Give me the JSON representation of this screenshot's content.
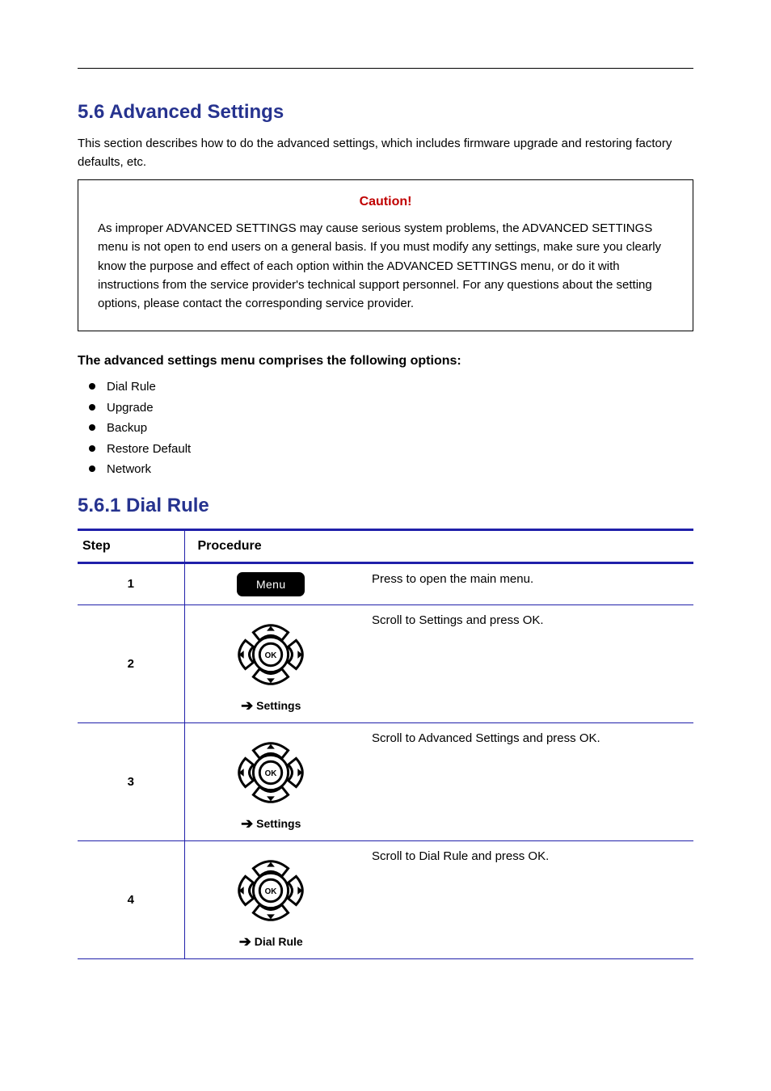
{
  "section5_6": {
    "heading": "5.6 Advanced Settings",
    "intro": "This section describes how to do the advanced settings, which includes firmware upgrade and restoring factory defaults, etc.",
    "callout_title": "Caution!",
    "callout_body": "As improper ADVANCED SETTINGS may cause serious system problems, the ADVANCED SETTINGS menu is not open to end users on a general basis. If you must modify any settings, make sure you clearly know the purpose and effect of each option within the ADVANCED SETTINGS menu, or do it with instructions from the service provider's technical support personnel. For any questions about the setting options, please contact the corresponding service provider.",
    "subhead": "The advanced settings menu comprises the following options:",
    "bullets": [
      "Dial Rule",
      "Upgrade",
      "Backup",
      "Restore Default",
      "Network"
    ]
  },
  "section5_6_1": {
    "heading": "5.6.1 Dial Rule"
  },
  "table": {
    "col_step": "Step",
    "col_procedure": "Procedure",
    "rows": [
      {
        "step": "1",
        "menu_label": "Menu",
        "arrow_word": "",
        "desc": "Press to open the main menu."
      },
      {
        "step": "2",
        "menu_label": "",
        "arrow_word": "Settings",
        "desc": "Scroll to Settings and press OK."
      },
      {
        "step": "3",
        "menu_label": "",
        "arrow_word": "Settings",
        "desc": "Scroll to Advanced Settings and press OK."
      },
      {
        "step": "4",
        "menu_label": "",
        "arrow_word": "Dial Rule",
        "desc": "Scroll to Dial Rule and press OK."
      }
    ]
  }
}
